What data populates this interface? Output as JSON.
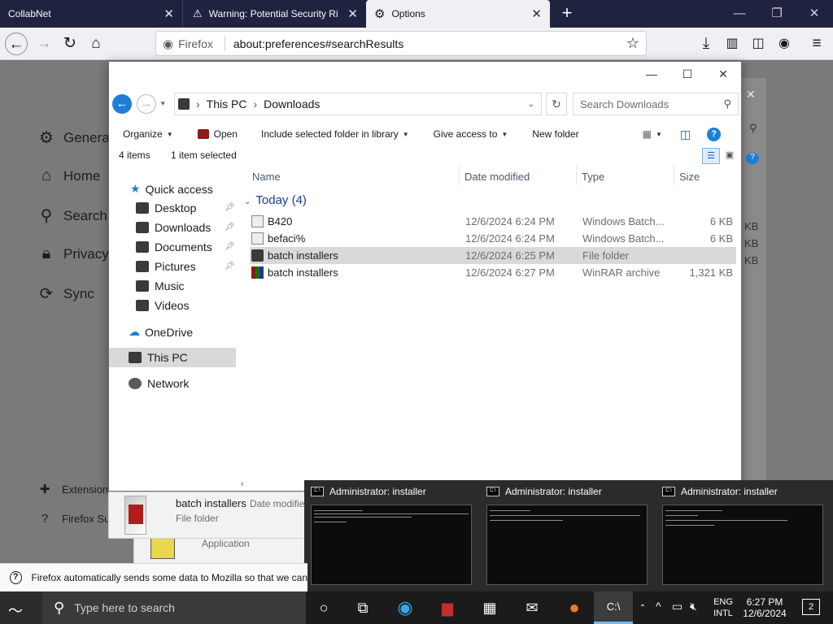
{
  "browser": {
    "tabs": [
      {
        "label": "CollabNet"
      },
      {
        "label": "Warning: Potential Security Ri"
      },
      {
        "label": "Options"
      }
    ],
    "identity_label": "Firefox",
    "url": "about:preferences#searchResults"
  },
  "prefs": {
    "nav": [
      {
        "label": "General"
      },
      {
        "label": "Home"
      },
      {
        "label": "Search"
      },
      {
        "label": "Privacy"
      },
      {
        "label": "Sync"
      }
    ],
    "footer": [
      {
        "label": "Extension"
      },
      {
        "label": "Firefox Su"
      }
    ],
    "notification": "Firefox automatically sends some data to Mozilla so that we can"
  },
  "behind_window": {
    "sizes": [
      "KB",
      "KB",
      "KB"
    ]
  },
  "explorer": {
    "path": [
      "This PC",
      "Downloads"
    ],
    "search_placeholder": "Search Downloads",
    "commands": [
      {
        "label": "Organize"
      },
      {
        "label": "Open"
      },
      {
        "label": "Include selected folder in library"
      },
      {
        "label": "Give access to"
      },
      {
        "label": "New folder"
      }
    ],
    "status": {
      "items": "4 items",
      "selected": "1 item selected"
    },
    "nav": {
      "quick_access": "Quick access",
      "quick_items": [
        {
          "label": "Desktop"
        },
        {
          "label": "Downloads"
        },
        {
          "label": "Documents"
        },
        {
          "label": "Pictures"
        },
        {
          "label": "Music"
        },
        {
          "label": "Videos"
        }
      ],
      "onedrive": "OneDrive",
      "this_pc": "This PC",
      "network": "Network"
    },
    "columns": {
      "name": "Name",
      "date": "Date modified",
      "type": "Type",
      "size": "Size"
    },
    "group": "Today (4)",
    "files": [
      {
        "name": "B420",
        "date": "12/6/2024 6:24 PM",
        "type": "Windows Batch...",
        "size": "6 KB"
      },
      {
        "name": "befaci%",
        "date": "12/6/2024 6:24 PM",
        "type": "Windows Batch...",
        "size": "6 KB"
      },
      {
        "name": "batch installers",
        "date": "12/6/2024 6:25 PM",
        "type": "File folder",
        "size": ""
      },
      {
        "name": "batch installers",
        "date": "12/6/2024 6:27 PM",
        "type": "WinRAR archive",
        "size": "1,321 KB"
      }
    ]
  },
  "preview": {
    "name": "batch installers",
    "date_label": "Date modifie",
    "type": "File folder",
    "behind_label": "Application"
  },
  "thumbnails": [
    {
      "title": "Administrator:  installer"
    },
    {
      "title": "Administrator:  installer"
    },
    {
      "title": "Administrator:  installer"
    }
  ],
  "taskbar": {
    "search_placeholder": "Type here to search",
    "lang_top": "ENG",
    "lang_bottom": "INTL",
    "time": "6:27 PM",
    "date": "12/6/2024",
    "notifications": "2"
  },
  "colors": {
    "accent": "#1e7fd6",
    "tabbar": "#202340",
    "taskbar": "#1b1b1b"
  }
}
